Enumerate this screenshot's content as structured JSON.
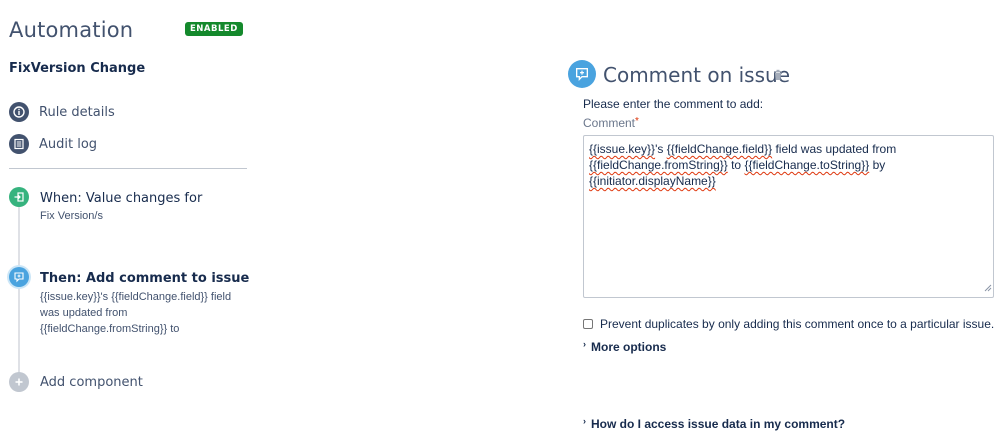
{
  "app": {
    "title": "Automation",
    "status_badge": "ENABLED",
    "rule_name": "FixVersion Change"
  },
  "nav": {
    "rule_details": "Rule details",
    "audit_log": "Audit log"
  },
  "steps": {
    "when_title": "When: Value changes for",
    "when_sub": "Fix Version/s",
    "then_title": "Then: Add comment to issue",
    "then_line1": "{{issue.key}}'s {{fieldChange.field}} field",
    "then_line2": "was updated from",
    "then_line3": "{{fieldChange.fromString}} to",
    "add_component": "Add component"
  },
  "panel": {
    "title": "Comment on issue",
    "prompt": "Please enter the comment to add:",
    "field_label": "Comment",
    "required_mark": "*",
    "comment": {
      "p1": "{{issue.key}}",
      "p2": "'s ",
      "p3": "{{fieldChange.field}}",
      "p4": " field was updated from",
      "p5": "{{fieldChange.fromString}}",
      "p6": " to ",
      "p7": "{{fieldChange.toString}}",
      "p8": " by",
      "p9": "{{initiator.displayName}}"
    },
    "prevent_duplicates": "Prevent duplicates by only adding this comment once to a particular issue.",
    "prevent_duplicates_checked": false,
    "more_options": "More options",
    "help_link": "How do I access issue data in my comment?"
  },
  "colors": {
    "badge_green": "#14892c",
    "trigger_green": "#36b37e",
    "action_blue": "#4aa3df",
    "nav_icon": "#42526e",
    "add_grey": "#c1c7d0"
  }
}
